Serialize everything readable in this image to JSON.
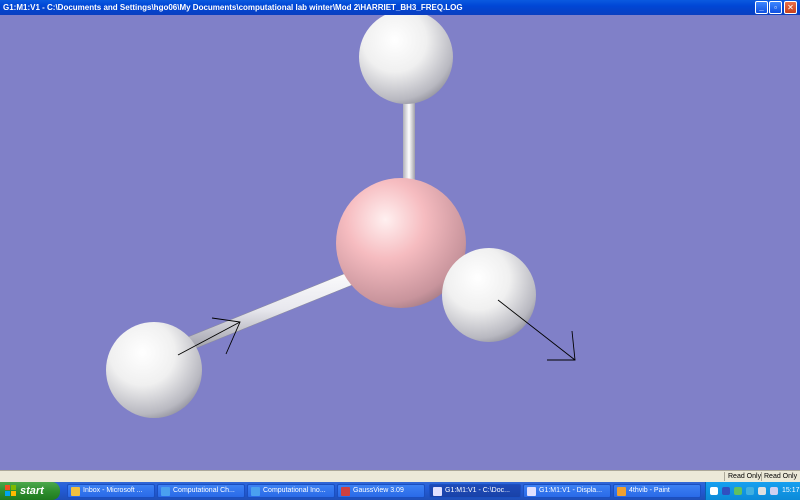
{
  "window": {
    "title": "G1:M1:V1 - C:\\Documents and Settings\\hgo06\\My Documents\\computational lab winter\\Mod 2\\HARRIET_BH3_FREQ.LOG",
    "minimize_glyph": "_",
    "maximize_glyph": "▫",
    "close_glyph": "✕"
  },
  "molecule": {
    "atoms": [
      {
        "element": "H",
        "color": "#f4f4f4"
      },
      {
        "element": "B",
        "color": "#f2b4b8"
      },
      {
        "element": "H",
        "color": "#f4f4f4"
      },
      {
        "element": "H",
        "color": "#f4f4f4"
      }
    ],
    "background_color": "#8080c8",
    "vector_color": "#000000"
  },
  "statusbar": {
    "read_only_1": "Read Only",
    "read_only_2": "Read Only"
  },
  "taskbar": {
    "start_label": "start",
    "tasks": [
      {
        "label": "Inbox - Microsoft ...",
        "icon": "outlook-icon"
      },
      {
        "label": "Computational Ch...",
        "icon": "ie-icon"
      },
      {
        "label": "Computational Ino...",
        "icon": "ie-icon"
      },
      {
        "label": "GaussView 3.09",
        "icon": "gaussview-icon"
      },
      {
        "label": "G1:M1:V1 - C:\\Doc...",
        "icon": "gaussview-doc-icon"
      },
      {
        "label": "G1:M1:V1 - Displa...",
        "icon": "gaussview-doc-icon"
      },
      {
        "label": "4thvib - Paint",
        "icon": "paint-icon"
      }
    ],
    "clock": "15:17"
  }
}
